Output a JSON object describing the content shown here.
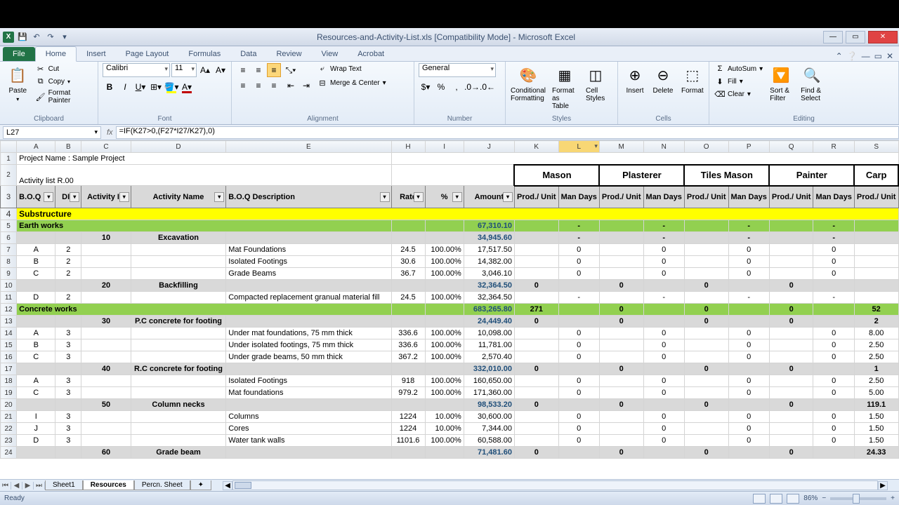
{
  "titlebar": {
    "title": "Resources-and-Activity-List.xls  [Compatibility Mode] - Microsoft Excel"
  },
  "qat": {
    "save": "💾",
    "undo": "↶",
    "redo": "↷"
  },
  "ribbon": {
    "file": "File",
    "tabs": [
      "Home",
      "Insert",
      "Page Layout",
      "Formulas",
      "Data",
      "Review",
      "View",
      "Acrobat"
    ],
    "clipboard": {
      "paste": "Paste",
      "cut": "Cut",
      "copy": "Copy",
      "painter": "Format Painter",
      "label": "Clipboard"
    },
    "font": {
      "name": "Calibri",
      "size": "11",
      "label": "Font"
    },
    "align": {
      "wrap": "Wrap Text",
      "merge": "Merge & Center",
      "label": "Alignment"
    },
    "number": {
      "format": "General",
      "label": "Number"
    },
    "styles": {
      "cond": "Conditional Formatting",
      "fmt": "Format as Table",
      "cell": "Cell Styles",
      "label": "Styles"
    },
    "cells": {
      "ins": "Insert",
      "del": "Delete",
      "fmt": "Format",
      "label": "Cells"
    },
    "editing": {
      "sum": "AutoSum",
      "fill": "Fill",
      "clear": "Clear",
      "sort": "Sort & Filter",
      "find": "Find & Select",
      "label": "Editing"
    }
  },
  "formula": {
    "cell": "L27",
    "fx": "=IF(K27>0,(F27*I27/K27),0)"
  },
  "cols": [
    "A",
    "B",
    "C",
    "D",
    "E",
    "H",
    "I",
    "J",
    "K",
    "L",
    "M",
    "N",
    "O",
    "P",
    "Q",
    "R",
    "S"
  ],
  "project": "Project Name : Sample Project",
  "activity": "Activity list R.00",
  "trades": [
    "Mason",
    "Plasterer",
    "Tiles Mason",
    "Painter",
    "Carp"
  ],
  "headers": {
    "boq": "B.O.Q Re",
    "div": "DIV",
    "aid": "Activity ID",
    "aname": "Activity Name",
    "desc": "B.O.Q Description",
    "rate": "Rate",
    "pct": "%",
    "amt": "Amount",
    "prod": "Prod./ Unit",
    "man": "Man Days"
  },
  "rows": [
    {
      "n": 4,
      "cls": "yellow-row",
      "boq": "Substructure"
    },
    {
      "n": 5,
      "cls": "green-row",
      "boq": "Earth works",
      "amt": "67,310.10",
      "dash": true
    },
    {
      "n": 6,
      "cls": "gray-row",
      "aid": "10",
      "aname": "Excavation",
      "amt": "34,945.60",
      "dash": true
    },
    {
      "n": 7,
      "boq": "A",
      "div": "2",
      "desc": "Mat Foundations",
      "rate": "24.5",
      "pct": "100.00%",
      "amt": "17,517.50",
      "zero": true
    },
    {
      "n": 8,
      "boq": "B",
      "div": "2",
      "desc": "Isolated Footings",
      "rate": "30.6",
      "pct": "100.00%",
      "amt": "14,382.00",
      "zero": true
    },
    {
      "n": 9,
      "boq": "C",
      "div": "2",
      "desc": "Grade Beams",
      "rate": "36.7",
      "pct": "100.00%",
      "amt": "3,046.10",
      "zero": true
    },
    {
      "n": 10,
      "cls": "gray-row",
      "aid": "20",
      "aname": "Backfilling",
      "amt": "32,364.50",
      "zerobold": true
    },
    {
      "n": 11,
      "boq": "D",
      "div": "2",
      "desc": "Compacted replacement granual material fill",
      "rate": "24.5",
      "pct": "100.00%",
      "amt": "32,364.50",
      "dash": true
    },
    {
      "n": 12,
      "cls": "green-row",
      "boq": "Concrete works",
      "amt": "683,265.80",
      "k": "271",
      "mnpq": "0",
      "s": "52"
    },
    {
      "n": 13,
      "cls": "gray-row",
      "aid": "30",
      "aname": "P.C concrete for footing",
      "amt": "24,449.40",
      "zerobold": true,
      "s": "2"
    },
    {
      "n": 14,
      "boq": "A",
      "div": "3",
      "desc": "Under mat foundations, 75 mm thick",
      "rate": "336.6",
      "pct": "100.00%",
      "amt": "10,098.00",
      "zero": true,
      "s": "8.00"
    },
    {
      "n": 15,
      "boq": "B",
      "div": "3",
      "desc": "Under isolated footings, 75 mm thick",
      "rate": "336.6",
      "pct": "100.00%",
      "amt": "11,781.00",
      "zero": true,
      "s": "2.50"
    },
    {
      "n": 16,
      "boq": "C",
      "div": "3",
      "desc": "Under grade beams, 50 mm thick",
      "rate": "367.2",
      "pct": "100.00%",
      "amt": "2,570.40",
      "zero": true,
      "s": "2.50"
    },
    {
      "n": 17,
      "cls": "gray-row",
      "aid": "40",
      "aname": "R.C concrete for footing",
      "amt": "332,010.00",
      "zerobold": true,
      "s": "1"
    },
    {
      "n": 18,
      "boq": "A",
      "div": "3",
      "desc": "Isolated Footings",
      "rate": "918",
      "pct": "100.00%",
      "amt": "160,650.00",
      "zero": true,
      "s": "2.50"
    },
    {
      "n": 19,
      "boq": "C",
      "div": "3",
      "desc": "Mat foundations",
      "rate": "979.2",
      "pct": "100.00%",
      "amt": "171,360.00",
      "zero": true,
      "s": "5.00"
    },
    {
      "n": 20,
      "cls": "gray-row",
      "aid": "50",
      "aname": "Column necks",
      "amt": "98,533.20",
      "zerobold": true,
      "s": "119.1"
    },
    {
      "n": 21,
      "boq": "I",
      "div": "3",
      "desc": "Columns",
      "rate": "1224",
      "pct": "10.00%",
      "amt": "30,600.00",
      "zero": true,
      "s": "1.50"
    },
    {
      "n": 22,
      "boq": "J",
      "div": "3",
      "desc": "Cores",
      "rate": "1224",
      "pct": "10.00%",
      "amt": "7,344.00",
      "zero": true,
      "s": "1.50"
    },
    {
      "n": 23,
      "boq": "D",
      "div": "3",
      "desc": "Water tank walls",
      "rate": "1101.6",
      "pct": "100.00%",
      "amt": "60,588.00",
      "zero": true,
      "s": "1.50"
    },
    {
      "n": 24,
      "cls": "gray-row",
      "aid": "60",
      "aname": "Grade beam",
      "amt": "71,481.60",
      "zerobold": true,
      "s": "24.33"
    }
  ],
  "sheets": [
    "Sheet1",
    "Resources",
    "Percn. Sheet"
  ],
  "status": {
    "ready": "Ready",
    "zoom": "86%"
  }
}
